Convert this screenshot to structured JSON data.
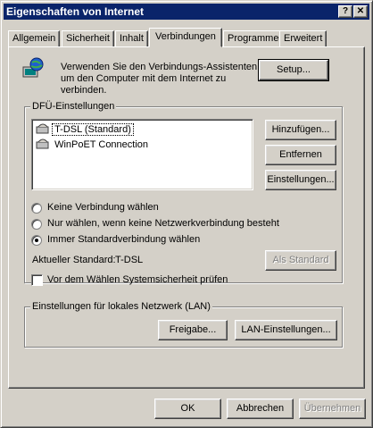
{
  "window": {
    "title": "Eigenschaften von Internet",
    "help_icon": "help-icon",
    "close_icon": "close-icon"
  },
  "tabs": [
    {
      "label": "Allgemein"
    },
    {
      "label": "Sicherheit"
    },
    {
      "label": "Inhalt"
    },
    {
      "label": "Verbindungen",
      "active": true
    },
    {
      "label": "Programme"
    },
    {
      "label": "Erweitert"
    }
  ],
  "wizard": {
    "text_line1": "Verwenden Sie den Verbindungs-Assistenten,",
    "text_line2": "um den Computer mit dem Internet zu",
    "text_line3": "verbinden.",
    "setup_button": "Setup...",
    "icon": "internet-globe-icon"
  },
  "dialup": {
    "legend": "DFÜ-Einstellungen",
    "connections": [
      {
        "label": "T-DSL (Standard)",
        "icon": "dialup-connection-icon",
        "selected": true
      },
      {
        "label": "WinPoET Connection",
        "icon": "dialup-connection-icon",
        "selected": false
      }
    ],
    "add_button": "Hinzufügen...",
    "remove_button": "Entfernen",
    "settings_button": "Einstellungen...",
    "radio_options": [
      {
        "label": "Keine Verbindung wählen",
        "checked": false
      },
      {
        "label": "Nur wählen, wenn keine Netzwerkverbindung besteht",
        "checked": false
      },
      {
        "label": "Immer Standardverbindung wählen",
        "checked": true
      }
    ],
    "current_default_label": "Aktueller Standard:",
    "current_default_value": "T-DSL",
    "set_default_button": "Als Standard",
    "security_check_label": "Vor dem Wählen Systemsicherheit prüfen",
    "security_check_checked": false
  },
  "lan": {
    "legend": "Einstellungen für lokales Netzwerk (LAN)",
    "share_button": "Freigabe...",
    "lan_settings_button": "LAN-Einstellungen..."
  },
  "footer": {
    "ok": "OK",
    "cancel": "Abbrechen",
    "apply": "Übernehmen"
  },
  "colors": {
    "face": "#d4d0c8",
    "titlebar": "#0a246a",
    "window_bg": "#ffffff"
  }
}
